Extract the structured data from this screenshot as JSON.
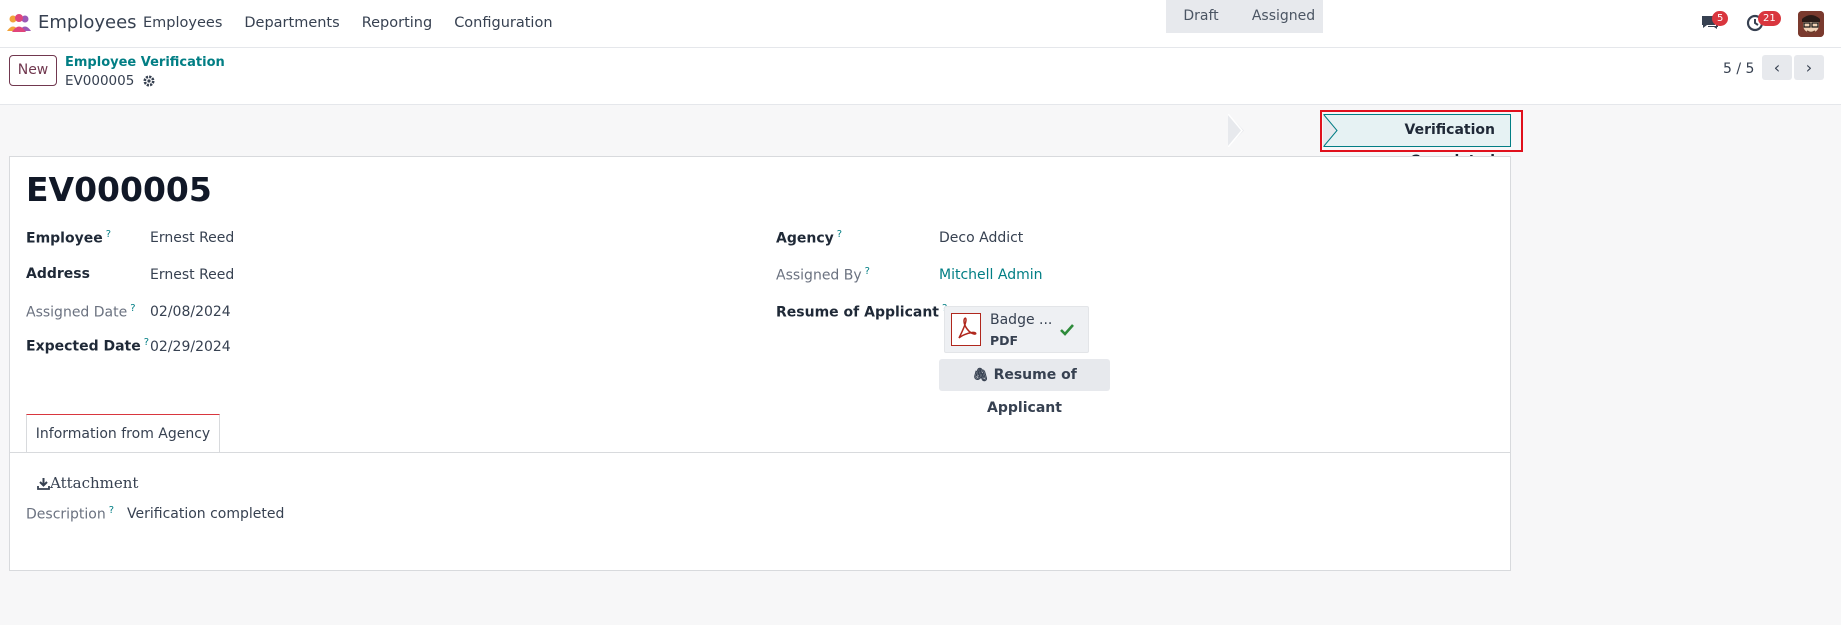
{
  "navbar": {
    "app_name": "Employees",
    "menu": [
      "Employees",
      "Departments",
      "Reporting",
      "Configuration"
    ],
    "messages_count": "5",
    "activities_count": "21"
  },
  "control": {
    "new_label": "New",
    "breadcrumb_parent": "Employee Verification",
    "breadcrumb_current": "EV000005",
    "pager": "5 / 5"
  },
  "status": {
    "stages": [
      "Draft",
      "Assigned",
      "Verification Completed"
    ],
    "active": "Verification Completed"
  },
  "form": {
    "title": "EV000005",
    "employee_label": "Employee",
    "employee_value": "Ernest Reed",
    "address_label": "Address",
    "address_value": "Ernest Reed",
    "assigned_date_label": "Assigned Date",
    "assigned_date_value": "02/08/2024",
    "expected_date_label": "Expected Date",
    "expected_date_value": "02/29/2024",
    "agency_label": "Agency",
    "agency_value": "Deco Addict",
    "assigned_by_label": "Assigned By",
    "assigned_by_value": "Mitchell Admin",
    "resume_label": "Resume of Applicant",
    "file_name": "Badge ...",
    "file_type": "PDF",
    "resume_button": "Resume of Applicant",
    "help_mark": "?"
  },
  "tabs": {
    "active": "Information from Agency"
  },
  "agency_info": {
    "attachment_label": "Attachment",
    "description_label": "Description",
    "description_value": "Verification completed"
  },
  "colors": {
    "brand": "#71384f",
    "link": "#017e84",
    "badge": "#d9363e",
    "highlight": "#e0101c"
  }
}
